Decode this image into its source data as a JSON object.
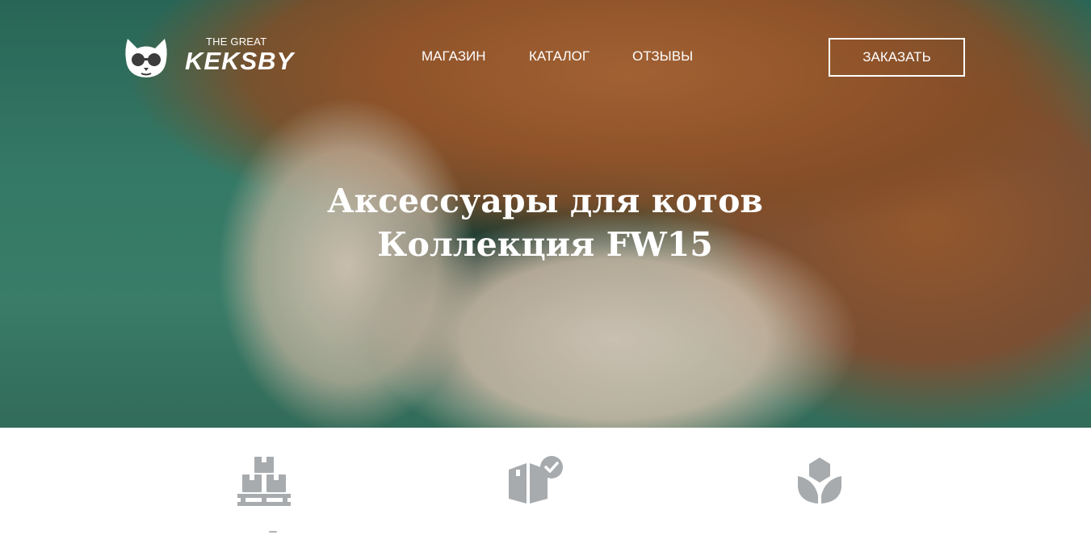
{
  "header": {
    "logo": {
      "tagline": "THE GREAT",
      "name": "KEKSBY"
    },
    "nav": [
      {
        "label": "МАГАЗИН"
      },
      {
        "label": "КАТАЛОГ"
      },
      {
        "label": "ОТЗЫВЫ"
      }
    ],
    "order_button": "ЗАКАЗАТЬ"
  },
  "hero": {
    "title_line1": "Аксессуары для котов",
    "title_line2": "Коллекция FW15"
  },
  "features": {
    "icons": [
      "boxes-pallet-icon",
      "box-check-icon",
      "flower-icon"
    ],
    "icon_color": "#a8abae"
  },
  "colors": {
    "hero_text": "#ffffff",
    "hero_fabric": "#3c8a74",
    "hero_fur": "#b86f3a"
  }
}
